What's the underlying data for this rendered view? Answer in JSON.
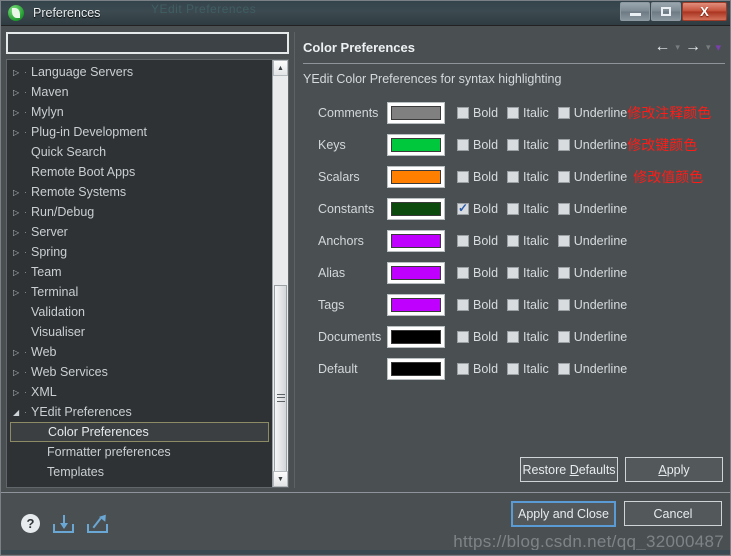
{
  "window": {
    "title": "Preferences",
    "ghost_title": "YEdit Preferences",
    "minimize_label": "Minimize",
    "maximize_label": "Maximize",
    "close_label": "X"
  },
  "sidebar": {
    "filter_value": "",
    "filter_placeholder": "",
    "items": [
      {
        "label": "Language Servers",
        "expandable": true,
        "child": false,
        "selected": false
      },
      {
        "label": "Maven",
        "expandable": true,
        "child": false,
        "selected": false
      },
      {
        "label": "Mylyn",
        "expandable": true,
        "child": false,
        "selected": false
      },
      {
        "label": "Plug-in Development",
        "expandable": true,
        "child": false,
        "selected": false
      },
      {
        "label": "Quick Search",
        "expandable": false,
        "child": false,
        "selected": false
      },
      {
        "label": "Remote Boot Apps",
        "expandable": false,
        "child": false,
        "selected": false
      },
      {
        "label": "Remote Systems",
        "expandable": true,
        "child": false,
        "selected": false
      },
      {
        "label": "Run/Debug",
        "expandable": true,
        "child": false,
        "selected": false
      },
      {
        "label": "Server",
        "expandable": true,
        "child": false,
        "selected": false
      },
      {
        "label": "Spring",
        "expandable": true,
        "child": false,
        "selected": false
      },
      {
        "label": "Team",
        "expandable": true,
        "child": false,
        "selected": false
      },
      {
        "label": "Terminal",
        "expandable": true,
        "child": false,
        "selected": false
      },
      {
        "label": "Validation",
        "expandable": false,
        "child": false,
        "selected": false
      },
      {
        "label": "Visualiser",
        "expandable": false,
        "child": false,
        "selected": false
      },
      {
        "label": "Web",
        "expandable": true,
        "child": false,
        "selected": false
      },
      {
        "label": "Web Services",
        "expandable": true,
        "child": false,
        "selected": false
      },
      {
        "label": "XML",
        "expandable": true,
        "child": false,
        "selected": false
      },
      {
        "label": "YEdit Preferences",
        "expandable": true,
        "expanded": true,
        "child": false,
        "selected": false
      },
      {
        "label": "Color Preferences",
        "expandable": false,
        "child": true,
        "selected": true
      },
      {
        "label": "Formatter preferences",
        "expandable": false,
        "child": true,
        "selected": false
      },
      {
        "label": "Templates",
        "expandable": false,
        "child": true,
        "selected": false
      }
    ]
  },
  "preferences": {
    "title": "Color Preferences",
    "description": "YEdit Color Preferences for syntax highlighting",
    "nav": {
      "back": "←",
      "back_caret": "▾",
      "forward": "→",
      "forward_caret": "▾",
      "menu_caret": "▾"
    },
    "checkbox_labels": {
      "bold": "Bold",
      "italic": "Italic",
      "underline": "Underline"
    },
    "rows": [
      {
        "label": "Comments",
        "color": "#808080",
        "bold": false,
        "italic": false,
        "underline": false,
        "annotation": "修改注释颜色"
      },
      {
        "label": "Keys",
        "color": "#00c83c",
        "bold": false,
        "italic": false,
        "underline": false,
        "annotation": "修改键颜色"
      },
      {
        "label": "Scalars",
        "color": "#ff8000",
        "bold": false,
        "italic": false,
        "underline": false,
        "annotation": "修改值颜色"
      },
      {
        "label": "Constants",
        "color": "#0d4a0d",
        "bold": true,
        "italic": false,
        "underline": false,
        "annotation": ""
      },
      {
        "label": "Anchors",
        "color": "#c000ff",
        "bold": false,
        "italic": false,
        "underline": false,
        "annotation": ""
      },
      {
        "label": "Alias",
        "color": "#c000ff",
        "bold": false,
        "italic": false,
        "underline": false,
        "annotation": ""
      },
      {
        "label": "Tags",
        "color": "#c000ff",
        "bold": false,
        "italic": false,
        "underline": false,
        "annotation": ""
      },
      {
        "label": "Documents",
        "color": "#000000",
        "bold": false,
        "italic": false,
        "underline": false,
        "annotation": ""
      },
      {
        "label": "Default",
        "color": "#000000",
        "bold": false,
        "italic": false,
        "underline": false,
        "annotation": ""
      }
    ],
    "restore_defaults_label": "Restore Defaults",
    "apply_label": "Apply"
  },
  "footer": {
    "help_glyph": "?",
    "import_label": "Import",
    "export_label": "Export",
    "apply_and_close_label": "Apply and Close",
    "cancel_label": "Cancel",
    "watermark": "https://blog.csdn.net/qq_32000487"
  }
}
